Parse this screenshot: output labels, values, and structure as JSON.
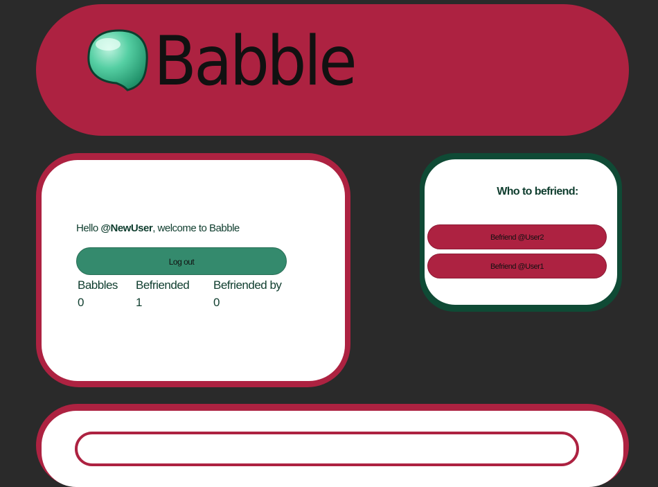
{
  "header": {
    "brand": "Babble",
    "logo_icon": "speech-bubble-icon",
    "colors": {
      "primary": "#ad2241",
      "accent": "#348a6d",
      "dark_green": "#0f4a35",
      "background": "#2a2a2a"
    }
  },
  "profile": {
    "greeting_prefix": "Hello ",
    "username": "@NewUser",
    "greeting_suffix": ", welcome to Babble",
    "logout_label": "Log out",
    "stats": [
      {
        "label": "Babbles",
        "value": "0"
      },
      {
        "label": "Befriended",
        "value": "1"
      },
      {
        "label": "Befriended by",
        "value": "0"
      }
    ]
  },
  "suggestions": {
    "title": "Who to befriend:",
    "items": [
      {
        "label": "Befriend @User2"
      },
      {
        "label": "Befriend @User1"
      }
    ]
  }
}
